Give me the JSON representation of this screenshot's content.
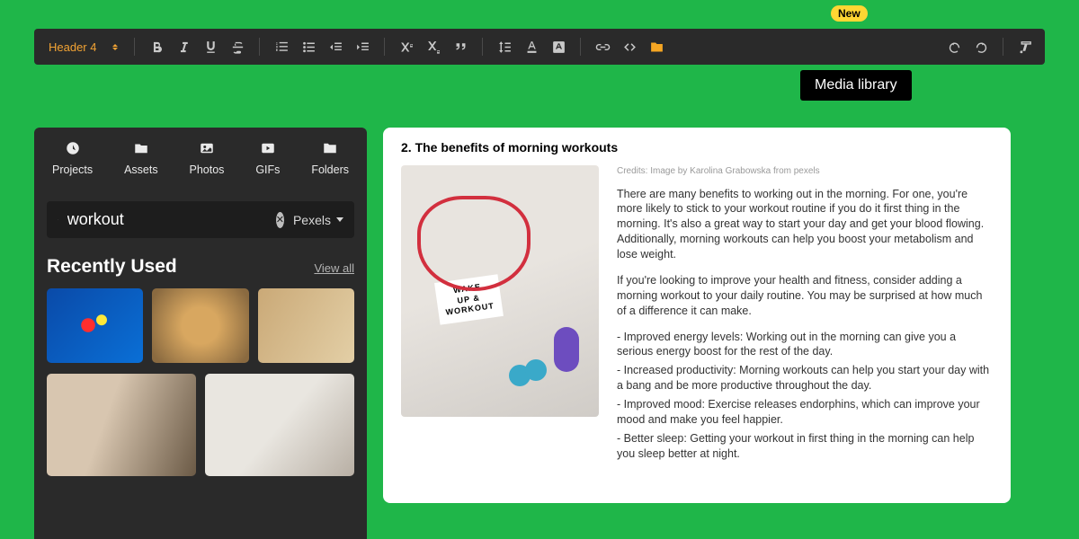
{
  "toolbar": {
    "headerLabel": "Header 4"
  },
  "badge": "New",
  "tooltip": "Media library",
  "sidebar": {
    "tabs": [
      {
        "label": "Projects"
      },
      {
        "label": "Assets"
      },
      {
        "label": "Photos"
      },
      {
        "label": "GIFs"
      },
      {
        "label": "Folders"
      }
    ],
    "searchValue": "workout",
    "source": "Pexels",
    "recentTitle": "Recently Used",
    "viewAll": "View all"
  },
  "article": {
    "title": "2. The benefits of morning workouts",
    "credits": "Credits: Image by Karolina Grabowska from pexels",
    "p1": "There are many benefits to working out in the morning. For one, you're more likely to stick to your workout routine if you do it first thing in the morning. It's also a great way to start your day and get your blood flowing. Additionally, morning workouts can help you boost your metabolism and lose weight.",
    "p2": "If you're looking to improve your health and fitness, consider adding a morning workout to your daily routine. You may be surprised at how much of a difference it can make.",
    "bullets": [
      "- Improved energy levels: Working out in the morning can give you a serious energy boost for the rest of the day.",
      "- Increased productivity: Morning workouts can help you start your day with a bang and be more productive throughout the day.",
      "- Improved mood: Exercise releases endorphins, which can improve your mood and make you feel happier.",
      "- Better sleep: Getting your workout in first thing in the morning can help you sleep better at night."
    ]
  }
}
